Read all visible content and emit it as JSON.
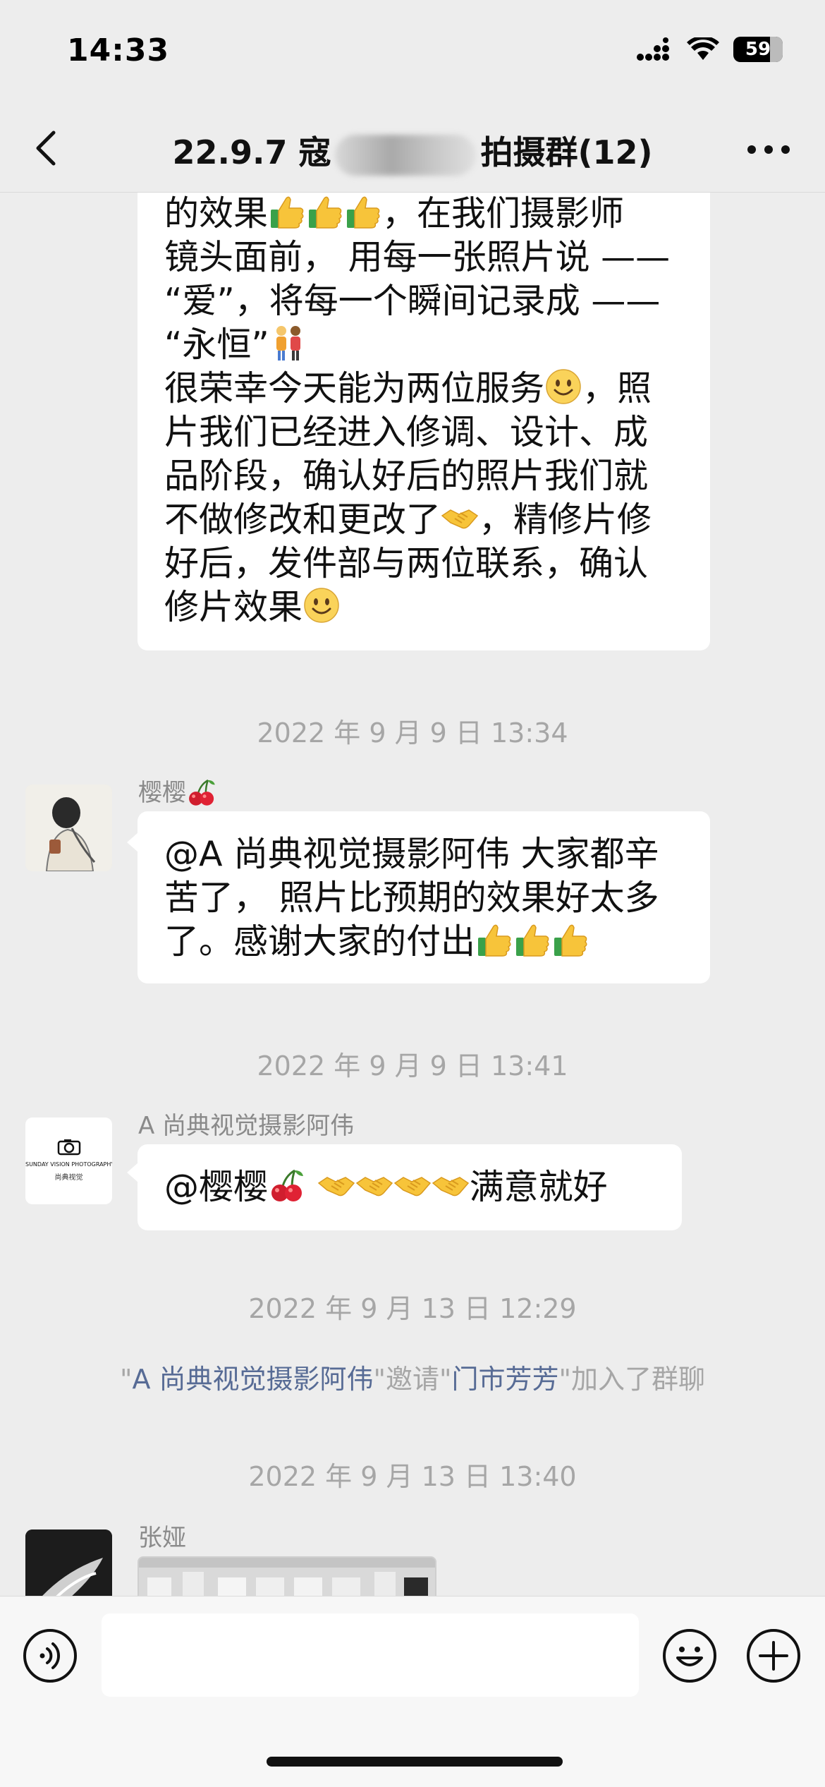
{
  "status": {
    "time": "14:33",
    "battery": "59"
  },
  "nav": {
    "title_left": "22.9.7 寇",
    "title_right": "拍摄群(12)"
  },
  "messages": {
    "top": {
      "line1": "的效果",
      "line1b": "，在我们摄影师",
      "line2": "镜头面前， 用每一张照片说 ——",
      "line3": "“爱”，将每一个瞬间记录成 ——",
      "line4": "“永恒”",
      "line5": "很荣幸今天能为两位服务",
      "line5b": "，照",
      "line6": "片我们已经进入修调、设计、成",
      "line7": "品阶段，确认好后的照片我们就",
      "line8": "不做修改和更改了",
      "line8b": "，精修片修",
      "line9": "好后，发件部与两位联系，确认",
      "line10": "修片效果"
    },
    "ts1": "2022 年 9 月 9 日 13:34",
    "m1": {
      "sender": "樱樱",
      "line1": "@A 尚典视觉摄影阿伟 大家都辛",
      "line2": "苦了， 照片比预期的效果好太多",
      "line3": "了。感谢大家的付出"
    },
    "ts2": "2022 年 9 月 9 日 13:41",
    "m2": {
      "sender": "A 尚典视觉摄影阿伟",
      "text_a": "@樱樱",
      "text_b": "满意就好",
      "avatar_line1": "SUNDAY VISION PHOTOGRAPHY",
      "avatar_line2": "尚典视觉"
    },
    "ts3": "2022 年 9 月 13 日 12:29",
    "system": {
      "q1": "\"",
      "inviter": "A 尚典视觉摄影阿伟",
      "mid": "\"邀请\"",
      "invitee": "门市芳芳",
      "tail": "\"加入了群聊"
    },
    "ts4": "2022 年 9 月 13 日 13:40",
    "m3": {
      "sender": "张娅"
    }
  },
  "colors": {
    "background": "#ededed",
    "bubble": "#ffffff",
    "link": "#576b95",
    "timestamp": "#a6a6a6"
  },
  "icons": [
    "back-icon",
    "more-icon",
    "voice-icon",
    "emoji-icon",
    "plus-icon",
    "thumbs-up-emoji",
    "handshake-emoji",
    "smile-emoji",
    "couple-emoji",
    "cherry-emoji"
  ]
}
